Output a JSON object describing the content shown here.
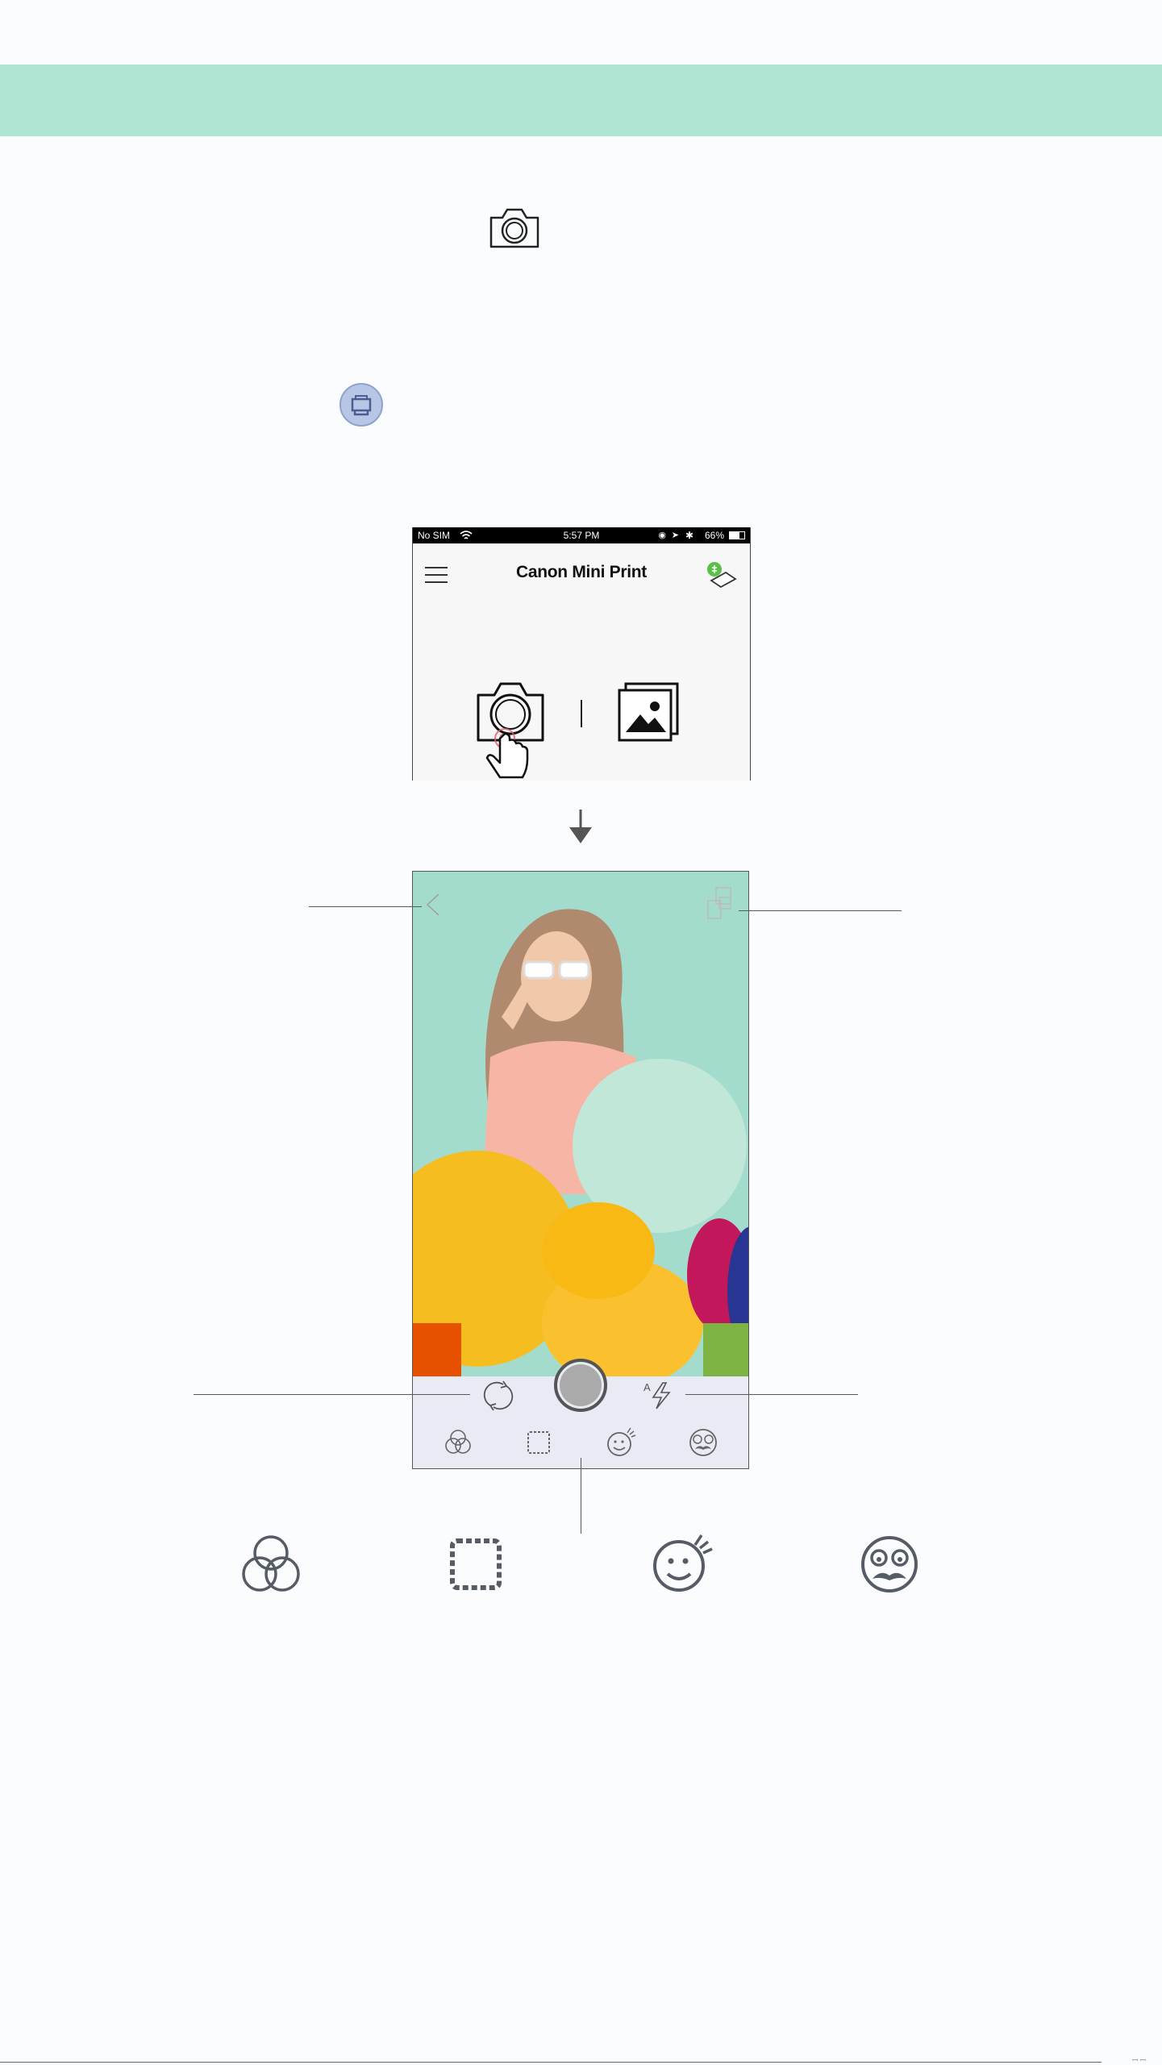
{
  "banner": {
    "color": "#b1e5d3"
  },
  "inline_icons": [
    {
      "name": "camera-icon"
    },
    {
      "name": "printer-icon",
      "color": "#b7c6e5"
    }
  ],
  "home_screen": {
    "status_bar": {
      "carrier": "No SIM",
      "time": "5:57 PM",
      "battery": "66%"
    },
    "app_title": "Canon Mini Print",
    "icons": [
      "menu-icon",
      "printer-status-icon",
      "camera-icon",
      "gallery-icon"
    ]
  },
  "camera_screen": {
    "top_icons": [
      "back-icon",
      "collage-icon"
    ],
    "controls": [
      "switch-camera-icon",
      "shutter-button",
      "auto-flash-icon"
    ],
    "flash_label": "A",
    "tabs": [
      "filters-icon",
      "frames-icon",
      "stickers-icon",
      "ar-effects-icon"
    ]
  },
  "large_icons": [
    "filters-icon",
    "frames-icon",
    "stickers-icon",
    "ar-effects-icon"
  ],
  "footer": {
    "page_mark": "ꟷ ꟷ"
  }
}
